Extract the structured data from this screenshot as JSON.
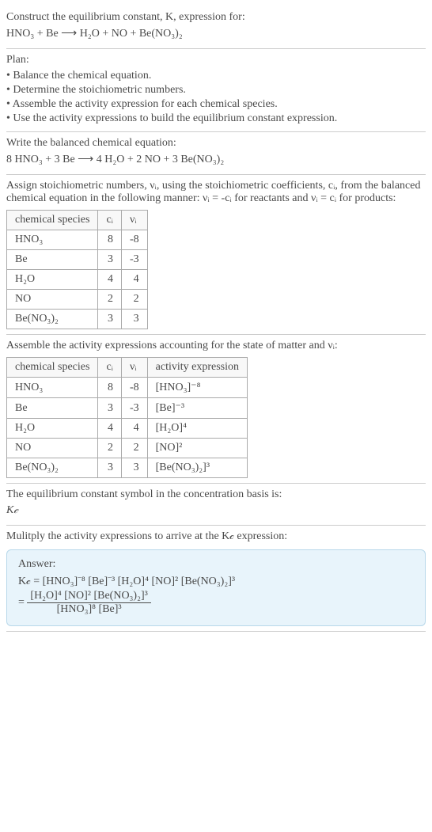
{
  "intro": {
    "line1": "Construct the equilibrium constant, K, expression for:",
    "equation": "HNO₃ + Be ⟶ H₂O + NO + Be(NO₃)₂"
  },
  "plan": {
    "title": "Plan:",
    "items": [
      "• Balance the chemical equation.",
      "• Determine the stoichiometric numbers.",
      "• Assemble the activity expression for each chemical species.",
      "• Use the activity expressions to build the equilibrium constant expression."
    ]
  },
  "balanced": {
    "line1": "Write the balanced chemical equation:",
    "equation": "8 HNO₃ + 3 Be ⟶ 4 H₂O + 2 NO + 3 Be(NO₃)₂"
  },
  "stoich": {
    "text": "Assign stoichiometric numbers, νᵢ, using the stoichiometric coefficients, cᵢ, from the balanced chemical equation in the following manner: νᵢ = -cᵢ for reactants and νᵢ = cᵢ for products:",
    "headers": [
      "chemical species",
      "cᵢ",
      "νᵢ"
    ],
    "rows": [
      {
        "sp": "HNO₃",
        "c": "8",
        "v": "-8"
      },
      {
        "sp": "Be",
        "c": "3",
        "v": "-3"
      },
      {
        "sp": "H₂O",
        "c": "4",
        "v": "4"
      },
      {
        "sp": "NO",
        "c": "2",
        "v": "2"
      },
      {
        "sp": "Be(NO₃)₂",
        "c": "3",
        "v": "3"
      }
    ]
  },
  "activity": {
    "text": "Assemble the activity expressions accounting for the state of matter and νᵢ:",
    "headers": [
      "chemical species",
      "cᵢ",
      "νᵢ",
      "activity expression"
    ],
    "rows": [
      {
        "sp": "HNO₃",
        "c": "8",
        "v": "-8",
        "a": "[HNO₃]⁻⁸"
      },
      {
        "sp": "Be",
        "c": "3",
        "v": "-3",
        "a": "[Be]⁻³"
      },
      {
        "sp": "H₂O",
        "c": "4",
        "v": "4",
        "a": "[H₂O]⁴"
      },
      {
        "sp": "NO",
        "c": "2",
        "v": "2",
        "a": "[NO]²"
      },
      {
        "sp": "Be(NO₃)₂",
        "c": "3",
        "v": "3",
        "a": "[Be(NO₃)₂]³"
      }
    ]
  },
  "symbolSection": {
    "line1": "The equilibrium constant symbol in the concentration basis is:",
    "symbol": "K𝒸"
  },
  "multiply": {
    "text": "Mulitply the activity expressions to arrive at the K𝒸 expression:"
  },
  "answer": {
    "label": "Answer:",
    "line1": "K𝒸 = [HNO₃]⁻⁸ [Be]⁻³ [H₂O]⁴ [NO]² [Be(NO₃)₂]³",
    "eq": "=",
    "fracTop": "[H₂O]⁴ [NO]² [Be(NO₃)₂]³",
    "fracBot": "[HNO₃]⁸ [Be]³"
  },
  "chart_data": {
    "type": "table",
    "title": "Stoichiometric coefficients and numbers",
    "columns": [
      "chemical species",
      "c_i",
      "ν_i"
    ],
    "rows": [
      [
        "HNO3",
        8,
        -8
      ],
      [
        "Be",
        3,
        -3
      ],
      [
        "H2O",
        4,
        4
      ],
      [
        "NO",
        2,
        2
      ],
      [
        "Be(NO3)2",
        3,
        3
      ]
    ]
  }
}
